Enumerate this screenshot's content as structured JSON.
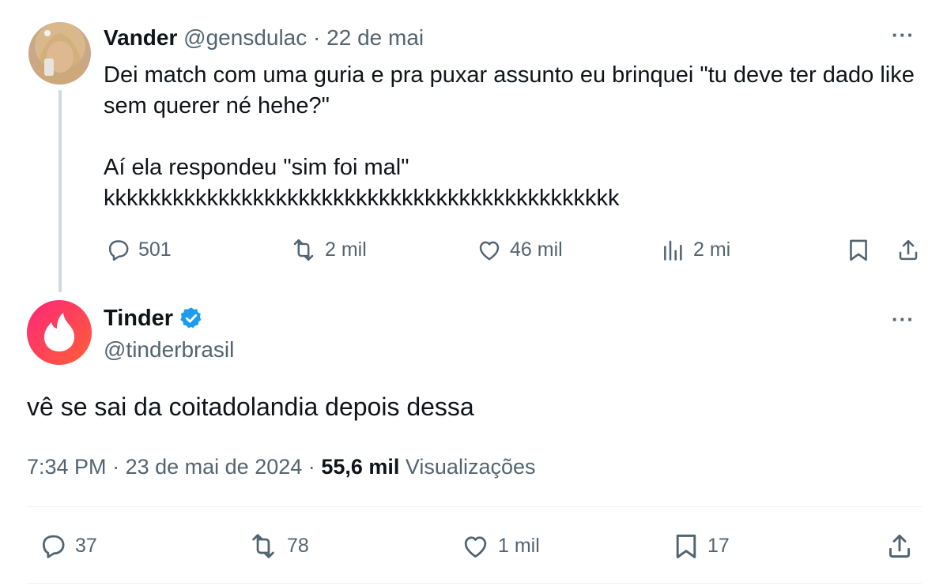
{
  "parent_tweet": {
    "author_name": "Vander",
    "handle": "@gensdulac",
    "separator": "·",
    "date": "22 de mai",
    "text": "Dei match com uma guria e pra puxar assunto eu brinquei \"tu deve ter dado like sem querer né hehe?\"\n\nAí ela respondeu \"sim foi mal\"\nkkkkkkkkkkkkkkkkkkkkkkkkkkkkkkkkkkkkkkkkkkkkk",
    "more_icon": "more-horizontal-icon",
    "actions": {
      "replies": "501",
      "retweets": "2 mil",
      "likes": "46 mil",
      "views": "2 mi"
    }
  },
  "main_tweet": {
    "author_name": "Tinder",
    "verified": true,
    "verified_color": "#1d9bf0",
    "handle": "@tinderbrasil",
    "text": "vê se sai da coitadolandia depois dessa",
    "time": "7:34 PM",
    "separator": "·",
    "date": "23 de mai de 2024",
    "views_count": "55,6 mil",
    "views_label": "Visualizações",
    "actions": {
      "replies": "37",
      "retweets": "78",
      "likes": "1 mil",
      "bookmarks": "17"
    }
  },
  "colors": {
    "text": "#0f1419",
    "muted": "#536471",
    "tinder_gradient_start": "#fd267a",
    "tinder_gradient_end": "#ff6036"
  }
}
